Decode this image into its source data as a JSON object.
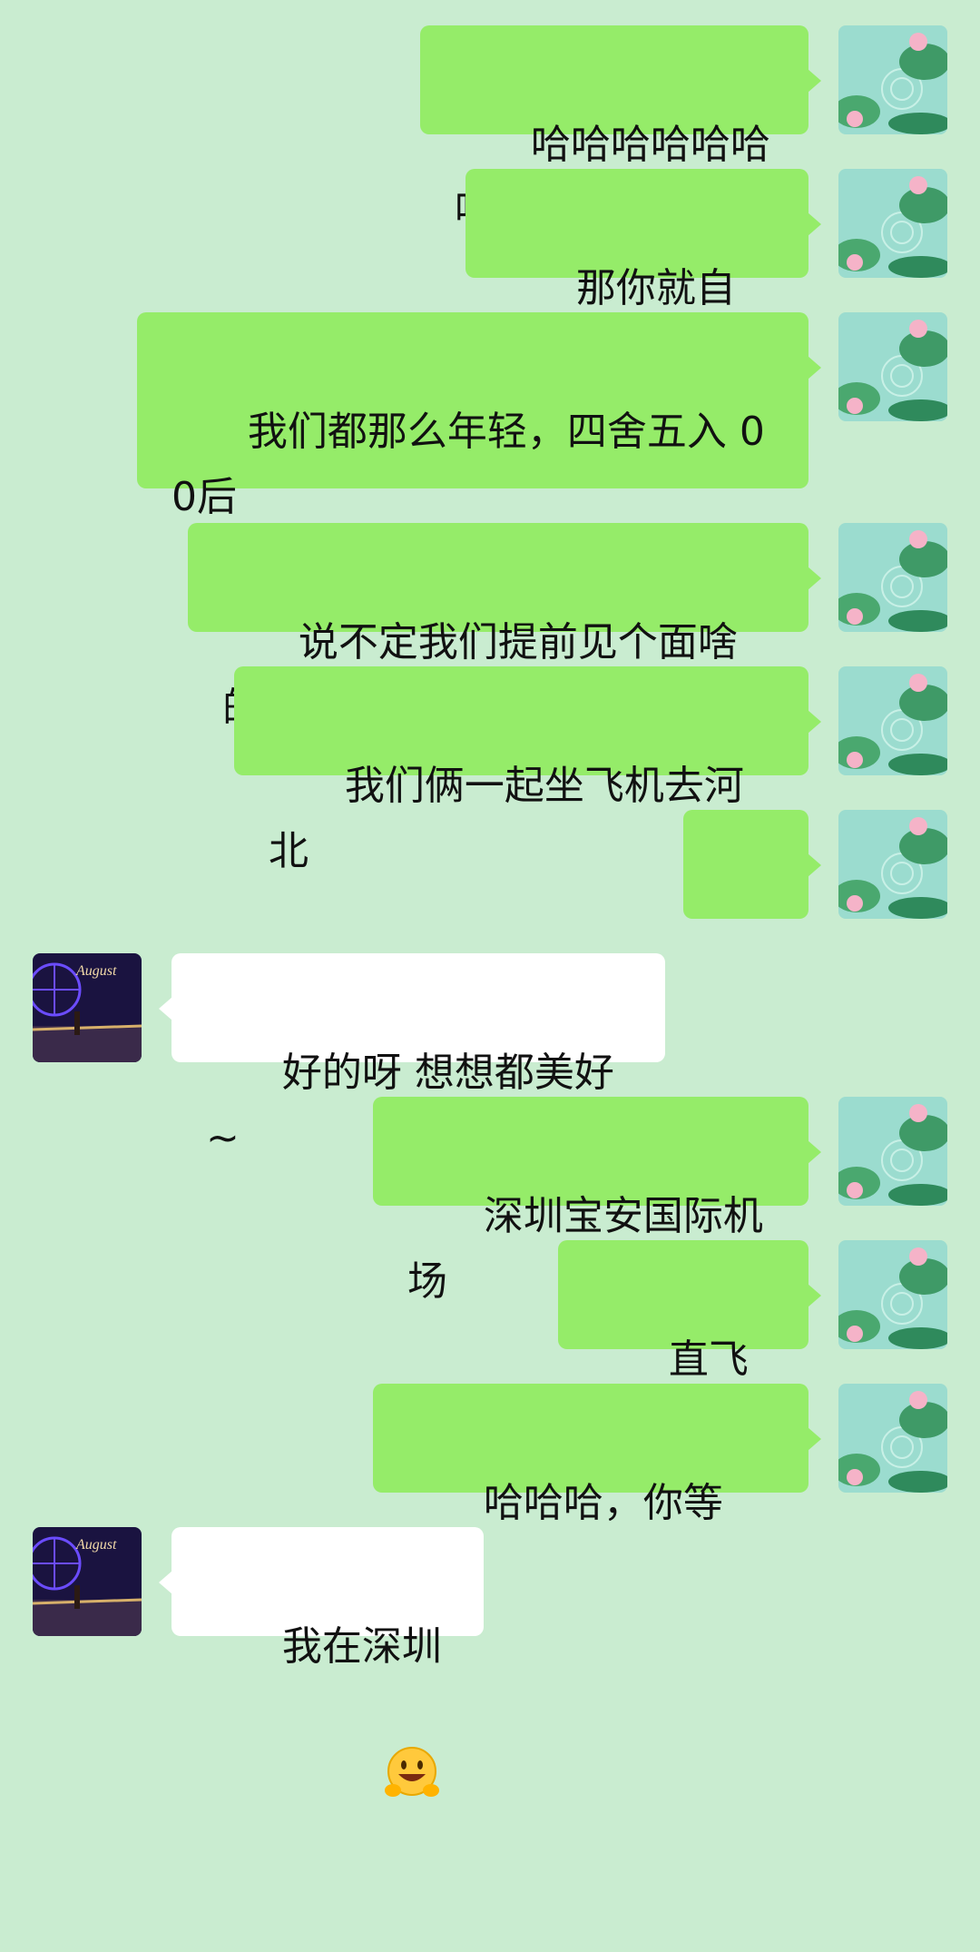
{
  "messages": [
    {
      "side": "me",
      "text": "哈哈哈哈哈哈哈"
    },
    {
      "side": "me",
      "text": "那你就自己来"
    },
    {
      "side": "me",
      "text": "我们都那么年轻，四舍五入 00后"
    },
    {
      "side": "me",
      "text": "说不定我们提前见个面啥的"
    },
    {
      "side": "me",
      "text": "我们俩一起坐飞机去河北"
    },
    {
      "side": "me",
      "text": "",
      "emoji": "facepalm-peek-emoji"
    },
    {
      "side": "other",
      "text": "好的呀 想想都美好 ~"
    },
    {
      "side": "me",
      "text": "深圳宝安国际机场"
    },
    {
      "side": "me",
      "text": "直飞河北"
    },
    {
      "side": "me",
      "text": "哈哈哈，你等我！"
    },
    {
      "side": "other",
      "text": "我在深圳",
      "emoji": "grin-hands-emoji"
    }
  ],
  "avatars": {
    "me": {
      "icon": "lotus-pond-avatar",
      "colors": [
        "#7fd0c2",
        "#3e9a6a",
        "#f3a6c0"
      ]
    },
    "other": {
      "icon": "ferris-wheel-night-avatar",
      "caption": "August",
      "colors": [
        "#1a1340",
        "#5a3cff",
        "#d7b06a"
      ]
    }
  },
  "colors": {
    "background": "#c9ecd0",
    "my_bubble": "#95ec69",
    "their_bubble": "#ffffff"
  }
}
